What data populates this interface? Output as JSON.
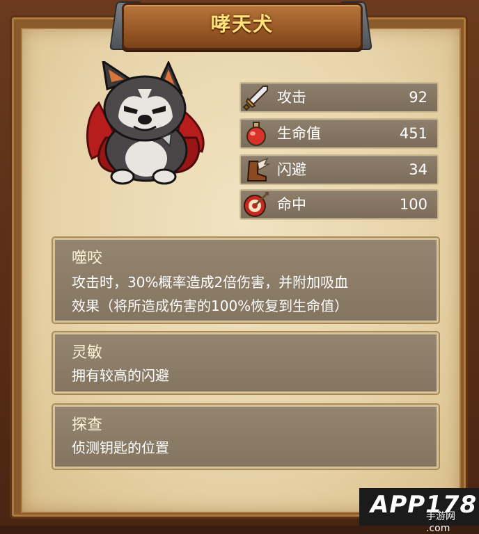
{
  "title": "哮天犬",
  "pet": {
    "portrait_icon": "husky-dog-with-red-cape"
  },
  "stats": [
    {
      "label": "攻击",
      "value": "92",
      "icon": "sword-icon"
    },
    {
      "label": "生命值",
      "value": "451",
      "icon": "potion-icon"
    },
    {
      "label": "闪避",
      "value": "34",
      "icon": "winged-boot-icon"
    },
    {
      "label": "命中",
      "value": "100",
      "icon": "target-icon"
    }
  ],
  "skills": [
    {
      "name": "噬咬",
      "desc_lines": [
        "攻击时，30%概率造成2倍伤害，并附加吸血",
        "效果（将所造成伤害的100%恢复到生命值）"
      ]
    },
    {
      "name": "灵敏",
      "desc_lines": [
        "拥有较高的闪避"
      ]
    },
    {
      "name": "探查",
      "desc_lines": [
        "侦测钥匙的位置"
      ]
    }
  ],
  "watermark": {
    "logo_text": "APP178",
    "sub_text": "手游网 .com"
  },
  "colors": {
    "title_gold": "#ffe27a",
    "parchment": "#e7d3a8",
    "panel": "#8a7c68"
  }
}
